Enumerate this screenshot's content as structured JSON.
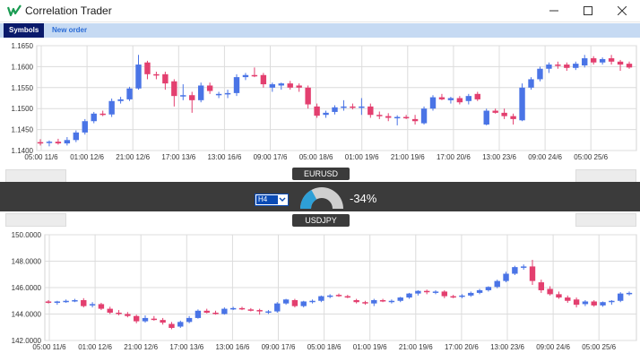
{
  "app": {
    "title": "Correlation Trader"
  },
  "tabs": [
    {
      "label": "Symbols"
    },
    {
      "label": "New order"
    }
  ],
  "correlation": {
    "timeframe": "H4",
    "value": "-34%",
    "symbol1": "EURUSD",
    "symbol2": "USDJPY",
    "gauge_level": 0.34
  },
  "colors": {
    "bull": "#4a74e6",
    "bear": "#e33f6f",
    "gauge_fill": "#2e9fd6",
    "tab_active": "#0a1a6b",
    "tab_bar": "#c6daf3"
  },
  "chart_data": [
    {
      "type": "candlestick",
      "symbol": "EURUSD",
      "ylim": [
        1.14,
        1.165
      ],
      "yticks": [
        "1.1650",
        "1.1600",
        "1.1550",
        "1.1500",
        "1.1450",
        "1.1400"
      ],
      "xticks": [
        "05:00 11/6",
        "01:00 12/6",
        "21:00 12/6",
        "17:00 13/6",
        "13:00 16/6",
        "09:00 17/6",
        "05:00 18/6",
        "01:00 19/6",
        "21:00 19/6",
        "17:00 20/6",
        "13:00 23/6",
        "09:00 24/6",
        "05:00 25/6"
      ],
      "grid": true,
      "candles": [
        {
          "o": 1.142,
          "h": 1.1427,
          "l": 1.1412,
          "c": 1.1418
        },
        {
          "o": 1.1418,
          "h": 1.1424,
          "l": 1.141,
          "c": 1.1421
        },
        {
          "o": 1.1421,
          "h": 1.1428,
          "l": 1.1414,
          "c": 1.1417
        },
        {
          "o": 1.1417,
          "h": 1.1432,
          "l": 1.1412,
          "c": 1.1425
        },
        {
          "o": 1.1425,
          "h": 1.1448,
          "l": 1.142,
          "c": 1.1443
        },
        {
          "o": 1.1443,
          "h": 1.1475,
          "l": 1.1438,
          "c": 1.147
        },
        {
          "o": 1.147,
          "h": 1.1492,
          "l": 1.1465,
          "c": 1.1488
        },
        {
          "o": 1.1488,
          "h": 1.1495,
          "l": 1.1482,
          "c": 1.1486
        },
        {
          "o": 1.1486,
          "h": 1.1524,
          "l": 1.148,
          "c": 1.1518
        },
        {
          "o": 1.1518,
          "h": 1.1528,
          "l": 1.1512,
          "c": 1.1522
        },
        {
          "o": 1.1522,
          "h": 1.1552,
          "l": 1.1518,
          "c": 1.1548
        },
        {
          "o": 1.1548,
          "h": 1.1628,
          "l": 1.1545,
          "c": 1.1605
        },
        {
          "o": 1.161,
          "h": 1.1614,
          "l": 1.157,
          "c": 1.1582
        },
        {
          "o": 1.1582,
          "h": 1.1588,
          "l": 1.157,
          "c": 1.158
        },
        {
          "o": 1.1582,
          "h": 1.1588,
          "l": 1.1545,
          "c": 1.156
        },
        {
          "o": 1.1565,
          "h": 1.157,
          "l": 1.1505,
          "c": 1.153
        },
        {
          "o": 1.153,
          "h": 1.1558,
          "l": 1.152,
          "c": 1.1532
        },
        {
          "o": 1.1532,
          "h": 1.154,
          "l": 1.149,
          "c": 1.152
        },
        {
          "o": 1.152,
          "h": 1.1562,
          "l": 1.1515,
          "c": 1.1555
        },
        {
          "o": 1.1555,
          "h": 1.1562,
          "l": 1.1535,
          "c": 1.1542
        },
        {
          "o": 1.1532,
          "h": 1.154,
          "l": 1.1525,
          "c": 1.1535
        },
        {
          "o": 1.1535,
          "h": 1.1545,
          "l": 1.1525,
          "c": 1.1537
        },
        {
          "o": 1.1537,
          "h": 1.1582,
          "l": 1.153,
          "c": 1.1575
        },
        {
          "o": 1.1575,
          "h": 1.1585,
          "l": 1.1568,
          "c": 1.158
        },
        {
          "o": 1.158,
          "h": 1.1598,
          "l": 1.1575,
          "c": 1.1578
        },
        {
          "o": 1.158,
          "h": 1.1585,
          "l": 1.155,
          "c": 1.1558
        },
        {
          "o": 1.155,
          "h": 1.1562,
          "l": 1.154,
          "c": 1.1558
        },
        {
          "o": 1.1555,
          "h": 1.1562,
          "l": 1.1545,
          "c": 1.156
        },
        {
          "o": 1.156,
          "h": 1.1566,
          "l": 1.1545,
          "c": 1.155
        },
        {
          "o": 1.1555,
          "h": 1.156,
          "l": 1.154,
          "c": 1.155
        },
        {
          "o": 1.155,
          "h": 1.1555,
          "l": 1.15,
          "c": 1.151
        },
        {
          "o": 1.1505,
          "h": 1.1512,
          "l": 1.1478,
          "c": 1.1483
        },
        {
          "o": 1.1485,
          "h": 1.1495,
          "l": 1.1478,
          "c": 1.149
        },
        {
          "o": 1.1492,
          "h": 1.1508,
          "l": 1.1486,
          "c": 1.1503
        },
        {
          "o": 1.1503,
          "h": 1.152,
          "l": 1.1495,
          "c": 1.1505
        },
        {
          "o": 1.1505,
          "h": 1.1512,
          "l": 1.1498,
          "c": 1.1502
        },
        {
          "o": 1.1502,
          "h": 1.1525,
          "l": 1.1485,
          "c": 1.1505
        },
        {
          "o": 1.1505,
          "h": 1.1512,
          "l": 1.1478,
          "c": 1.1485
        },
        {
          "o": 1.1485,
          "h": 1.1493,
          "l": 1.1475,
          "c": 1.1482
        },
        {
          "o": 1.1482,
          "h": 1.1489,
          "l": 1.147,
          "c": 1.1478
        },
        {
          "o": 1.1478,
          "h": 1.1484,
          "l": 1.146,
          "c": 1.148
        },
        {
          "o": 1.148,
          "h": 1.1485,
          "l": 1.1475,
          "c": 1.1478
        },
        {
          "o": 1.1475,
          "h": 1.1485,
          "l": 1.1462,
          "c": 1.147
        },
        {
          "o": 1.1465,
          "h": 1.1505,
          "l": 1.1462,
          "c": 1.15
        },
        {
          "o": 1.15,
          "h": 1.1532,
          "l": 1.1495,
          "c": 1.1527
        },
        {
          "o": 1.1527,
          "h": 1.1535,
          "l": 1.152,
          "c": 1.1522
        },
        {
          "o": 1.152,
          "h": 1.1528,
          "l": 1.1512,
          "c": 1.1525
        },
        {
          "o": 1.1525,
          "h": 1.153,
          "l": 1.151,
          "c": 1.1515
        },
        {
          "o": 1.1518,
          "h": 1.1535,
          "l": 1.151,
          "c": 1.153
        },
        {
          "o": 1.1535,
          "h": 1.154,
          "l": 1.1518,
          "c": 1.1522
        },
        {
          "o": 1.1462,
          "h": 1.15,
          "l": 1.146,
          "c": 1.1495
        },
        {
          "o": 1.1495,
          "h": 1.15,
          "l": 1.1488,
          "c": 1.149
        },
        {
          "o": 1.149,
          "h": 1.15,
          "l": 1.1475,
          "c": 1.1482
        },
        {
          "o": 1.1482,
          "h": 1.1488,
          "l": 1.1462,
          "c": 1.1475
        },
        {
          "o": 1.1472,
          "h": 1.156,
          "l": 1.147,
          "c": 1.155
        },
        {
          "o": 1.155,
          "h": 1.1575,
          "l": 1.1545,
          "c": 1.157
        },
        {
          "o": 1.157,
          "h": 1.16,
          "l": 1.1565,
          "c": 1.1595
        },
        {
          "o": 1.1595,
          "h": 1.161,
          "l": 1.1585,
          "c": 1.1605
        },
        {
          "o": 1.1605,
          "h": 1.1612,
          "l": 1.1595,
          "c": 1.1603
        },
        {
          "o": 1.1605,
          "h": 1.161,
          "l": 1.159,
          "c": 1.1597
        },
        {
          "o": 1.1597,
          "h": 1.1612,
          "l": 1.1592,
          "c": 1.1607
        },
        {
          "o": 1.1603,
          "h": 1.1628,
          "l": 1.1598,
          "c": 1.162
        },
        {
          "o": 1.162,
          "h": 1.1625,
          "l": 1.1605,
          "c": 1.161
        },
        {
          "o": 1.161,
          "h": 1.1622,
          "l": 1.1605,
          "c": 1.1618
        },
        {
          "o": 1.162,
          "h": 1.1628,
          "l": 1.1605,
          "c": 1.1612
        },
        {
          "o": 1.1612,
          "h": 1.1616,
          "l": 1.159,
          "c": 1.1605
        },
        {
          "o": 1.1607,
          "h": 1.1612,
          "l": 1.1595,
          "c": 1.1598
        }
      ]
    },
    {
      "type": "candlestick",
      "symbol": "USDJPY",
      "ylim": [
        142.0,
        150.0
      ],
      "yticks": [
        "150.0000",
        "148.0000",
        "146.0000",
        "144.0000",
        "142.0000"
      ],
      "xticks": [
        "05:00 11/6",
        "01:00 12/6",
        "21:00 12/6",
        "17:00 13/6",
        "13:00 16/6",
        "09:00 17/6",
        "05:00 18/6",
        "01:00 19/6",
        "21:00 19/6",
        "17:00 20/6",
        "13:00 23/6",
        "09:00 24/6",
        "05:00 25/6"
      ],
      "grid": true,
      "candles": [
        {
          "o": 144.95,
          "h": 145.05,
          "l": 144.8,
          "c": 144.9
        },
        {
          "o": 144.9,
          "h": 145.0,
          "l": 144.7,
          "c": 144.95
        },
        {
          "o": 144.95,
          "h": 145.1,
          "l": 144.85,
          "c": 145.0
        },
        {
          "o": 145.0,
          "h": 145.15,
          "l": 144.9,
          "c": 145.05
        },
        {
          "o": 145.05,
          "h": 145.2,
          "l": 144.5,
          "c": 144.6
        },
        {
          "o": 144.7,
          "h": 144.9,
          "l": 144.5,
          "c": 144.75
        },
        {
          "o": 144.75,
          "h": 144.85,
          "l": 144.3,
          "c": 144.4
        },
        {
          "o": 144.4,
          "h": 144.55,
          "l": 144.0,
          "c": 144.1
        },
        {
          "o": 144.1,
          "h": 144.3,
          "l": 143.9,
          "c": 144.0
        },
        {
          "o": 144.0,
          "h": 144.15,
          "l": 143.75,
          "c": 143.85
        },
        {
          "o": 143.85,
          "h": 143.95,
          "l": 143.3,
          "c": 143.45
        },
        {
          "o": 143.45,
          "h": 143.9,
          "l": 143.35,
          "c": 143.7
        },
        {
          "o": 143.65,
          "h": 143.85,
          "l": 143.5,
          "c": 143.55
        },
        {
          "o": 143.55,
          "h": 143.7,
          "l": 143.2,
          "c": 143.35
        },
        {
          "o": 143.25,
          "h": 143.4,
          "l": 142.85,
          "c": 142.95
        },
        {
          "o": 143.05,
          "h": 143.5,
          "l": 142.95,
          "c": 143.4
        },
        {
          "o": 143.4,
          "h": 143.85,
          "l": 143.3,
          "c": 143.7
        },
        {
          "o": 143.7,
          "h": 144.35,
          "l": 143.65,
          "c": 144.25
        },
        {
          "o": 144.25,
          "h": 144.4,
          "l": 144.05,
          "c": 144.1
        },
        {
          "o": 144.1,
          "h": 144.25,
          "l": 143.95,
          "c": 144.05
        },
        {
          "o": 144.0,
          "h": 144.5,
          "l": 143.95,
          "c": 144.4
        },
        {
          "o": 144.4,
          "h": 144.55,
          "l": 144.3,
          "c": 144.45
        },
        {
          "o": 144.45,
          "h": 144.55,
          "l": 144.3,
          "c": 144.35
        },
        {
          "o": 144.35,
          "h": 144.45,
          "l": 144.2,
          "c": 144.3
        },
        {
          "o": 144.3,
          "h": 144.4,
          "l": 143.95,
          "c": 144.2
        },
        {
          "o": 144.1,
          "h": 144.3,
          "l": 144.0,
          "c": 144.2
        },
        {
          "o": 144.2,
          "h": 144.9,
          "l": 144.1,
          "c": 144.8
        },
        {
          "o": 144.8,
          "h": 145.15,
          "l": 144.7,
          "c": 145.1
        },
        {
          "o": 145.05,
          "h": 145.15,
          "l": 144.5,
          "c": 144.6
        },
        {
          "o": 144.6,
          "h": 145.0,
          "l": 144.5,
          "c": 144.95
        },
        {
          "o": 144.95,
          "h": 145.1,
          "l": 144.8,
          "c": 145.0
        },
        {
          "o": 145.0,
          "h": 145.4,
          "l": 144.9,
          "c": 145.35
        },
        {
          "o": 145.35,
          "h": 145.5,
          "l": 145.2,
          "c": 145.4
        },
        {
          "o": 145.45,
          "h": 145.55,
          "l": 145.3,
          "c": 145.35
        },
        {
          "o": 145.35,
          "h": 145.45,
          "l": 145.2,
          "c": 145.25
        },
        {
          "o": 145.05,
          "h": 145.15,
          "l": 144.8,
          "c": 144.9
        },
        {
          "o": 144.9,
          "h": 145.0,
          "l": 144.7,
          "c": 144.8
        },
        {
          "o": 144.8,
          "h": 145.15,
          "l": 144.6,
          "c": 145.05
        },
        {
          "o": 145.05,
          "h": 145.15,
          "l": 144.9,
          "c": 144.95
        },
        {
          "o": 144.95,
          "h": 145.1,
          "l": 144.8,
          "c": 145.0
        },
        {
          "o": 145.0,
          "h": 145.3,
          "l": 144.9,
          "c": 145.25
        },
        {
          "o": 145.25,
          "h": 145.6,
          "l": 145.15,
          "c": 145.55
        },
        {
          "o": 145.55,
          "h": 145.8,
          "l": 145.4,
          "c": 145.75
        },
        {
          "o": 145.75,
          "h": 145.85,
          "l": 145.5,
          "c": 145.65
        },
        {
          "o": 145.65,
          "h": 145.8,
          "l": 145.5,
          "c": 145.7
        },
        {
          "o": 145.7,
          "h": 145.8,
          "l": 145.2,
          "c": 145.35
        },
        {
          "o": 145.35,
          "h": 145.45,
          "l": 145.2,
          "c": 145.3
        },
        {
          "o": 145.3,
          "h": 145.5,
          "l": 145.2,
          "c": 145.4
        },
        {
          "o": 145.4,
          "h": 145.7,
          "l": 145.3,
          "c": 145.6
        },
        {
          "o": 145.6,
          "h": 145.9,
          "l": 145.5,
          "c": 145.8
        },
        {
          "o": 145.8,
          "h": 146.1,
          "l": 145.7,
          "c": 146.05
        },
        {
          "o": 146.05,
          "h": 146.6,
          "l": 145.95,
          "c": 146.5
        },
        {
          "o": 146.5,
          "h": 147.2,
          "l": 146.4,
          "c": 147.05
        },
        {
          "o": 147.05,
          "h": 147.65,
          "l": 146.95,
          "c": 147.55
        },
        {
          "o": 147.55,
          "h": 147.75,
          "l": 147.35,
          "c": 147.6
        },
        {
          "o": 147.6,
          "h": 148.1,
          "l": 146.2,
          "c": 146.5
        },
        {
          "o": 146.4,
          "h": 146.6,
          "l": 145.6,
          "c": 145.8
        },
        {
          "o": 145.9,
          "h": 146.1,
          "l": 145.4,
          "c": 145.5
        },
        {
          "o": 145.5,
          "h": 145.7,
          "l": 145.15,
          "c": 145.25
        },
        {
          "o": 145.25,
          "h": 145.4,
          "l": 144.85,
          "c": 145.0
        },
        {
          "o": 145.1,
          "h": 145.25,
          "l": 144.5,
          "c": 144.7
        },
        {
          "o": 144.75,
          "h": 145.05,
          "l": 144.6,
          "c": 144.95
        },
        {
          "o": 144.95,
          "h": 145.05,
          "l": 144.55,
          "c": 144.65
        },
        {
          "o": 144.65,
          "h": 144.95,
          "l": 144.55,
          "c": 144.9
        },
        {
          "o": 144.9,
          "h": 145.05,
          "l": 144.7,
          "c": 145.0
        },
        {
          "o": 145.0,
          "h": 145.65,
          "l": 144.9,
          "c": 145.55
        },
        {
          "o": 145.55,
          "h": 145.7,
          "l": 145.4,
          "c": 145.6
        }
      ]
    }
  ]
}
